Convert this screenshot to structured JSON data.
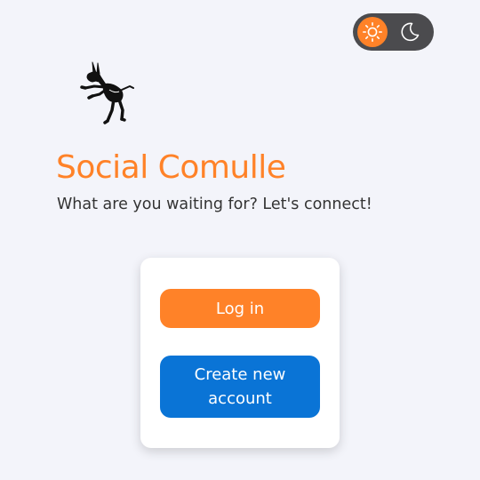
{
  "theme_toggle": {
    "active_mode": "light",
    "light_icon": "sun-icon",
    "dark_icon": "moon-icon",
    "colors": {
      "track": "#4b4b4e",
      "knob": "#ff8228"
    }
  },
  "brand": {
    "logo_icon": "kicking-donkey-logo",
    "title": "Social Comulle",
    "tagline": "What are you waiting for? Let's connect!"
  },
  "auth": {
    "login_label": "Log in",
    "create_account_label": "Create new account"
  },
  "colors": {
    "accent": "#ff8228",
    "primary_blue": "#0a74d6",
    "background": "#f3f4fa",
    "text": "#333333"
  }
}
